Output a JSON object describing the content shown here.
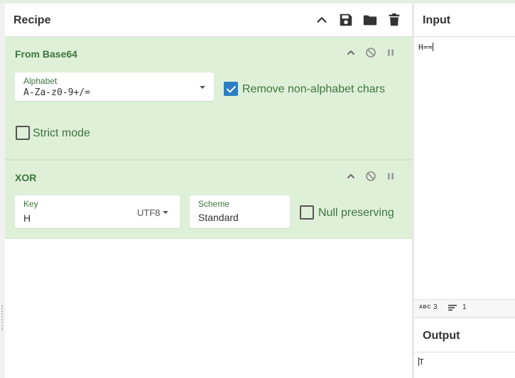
{
  "recipe": {
    "title": "Recipe"
  },
  "operations": [
    {
      "title": "From Base64",
      "alphabet": {
        "label": "Alphabet",
        "value": "A-Za-z0-9+/="
      },
      "remove_non_alphabet": {
        "label": "Remove non-alphabet chars",
        "checked": true
      },
      "strict_mode": {
        "label": "Strict mode",
        "checked": false
      }
    },
    {
      "title": "XOR",
      "key": {
        "label": "Key",
        "value": "H",
        "encoding": "UTF8"
      },
      "scheme": {
        "label": "Scheme",
        "value": "Standard"
      },
      "null_preserving": {
        "label": "Null preserving",
        "checked": false
      }
    }
  ],
  "input": {
    "title": "Input",
    "text": "H==",
    "status": {
      "abc_label": "ABC",
      "length": "3",
      "lines": "1"
    }
  },
  "output": {
    "title": "Output",
    "text": "T"
  },
  "colors": {
    "op_background": "#dff0d8",
    "op_text": "#3c763d",
    "checkbox_checked": "#2e7ec4"
  }
}
